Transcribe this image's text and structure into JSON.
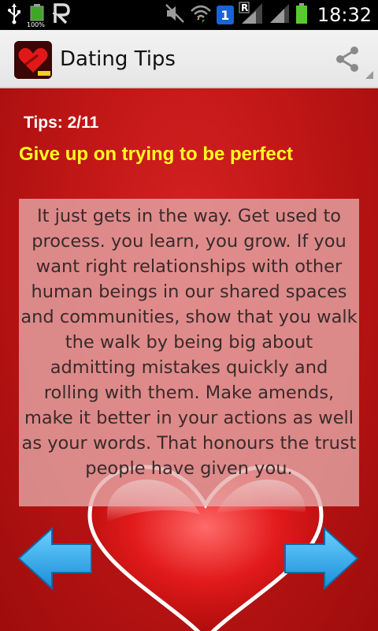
{
  "status_bar": {
    "battery_small_label": "100%",
    "sim_number": "1",
    "roaming_label": "R",
    "time": "18:32"
  },
  "action_bar": {
    "title": "Dating Tips",
    "share_icon": "share-icon"
  },
  "tip": {
    "counter": "Tips: 2/11",
    "title": "Give up on trying to be perfect",
    "body": "It just gets in the way. Get used to process. you learn, you grow. If you want right relationships with other human beings in our shared spaces and communities, show that you walk the walk by being big about admitting mistakes quickly and rolling with them. Make amends, make it better in your actions as well as your words. That honours the trust people have given you."
  },
  "navigation": {
    "prev_icon": "arrow-left-icon",
    "next_icon": "arrow-right-icon"
  },
  "colors": {
    "background_red": "#c01616",
    "title_yellow": "#ffff22",
    "arrow_blue": "#2aa8e8"
  }
}
